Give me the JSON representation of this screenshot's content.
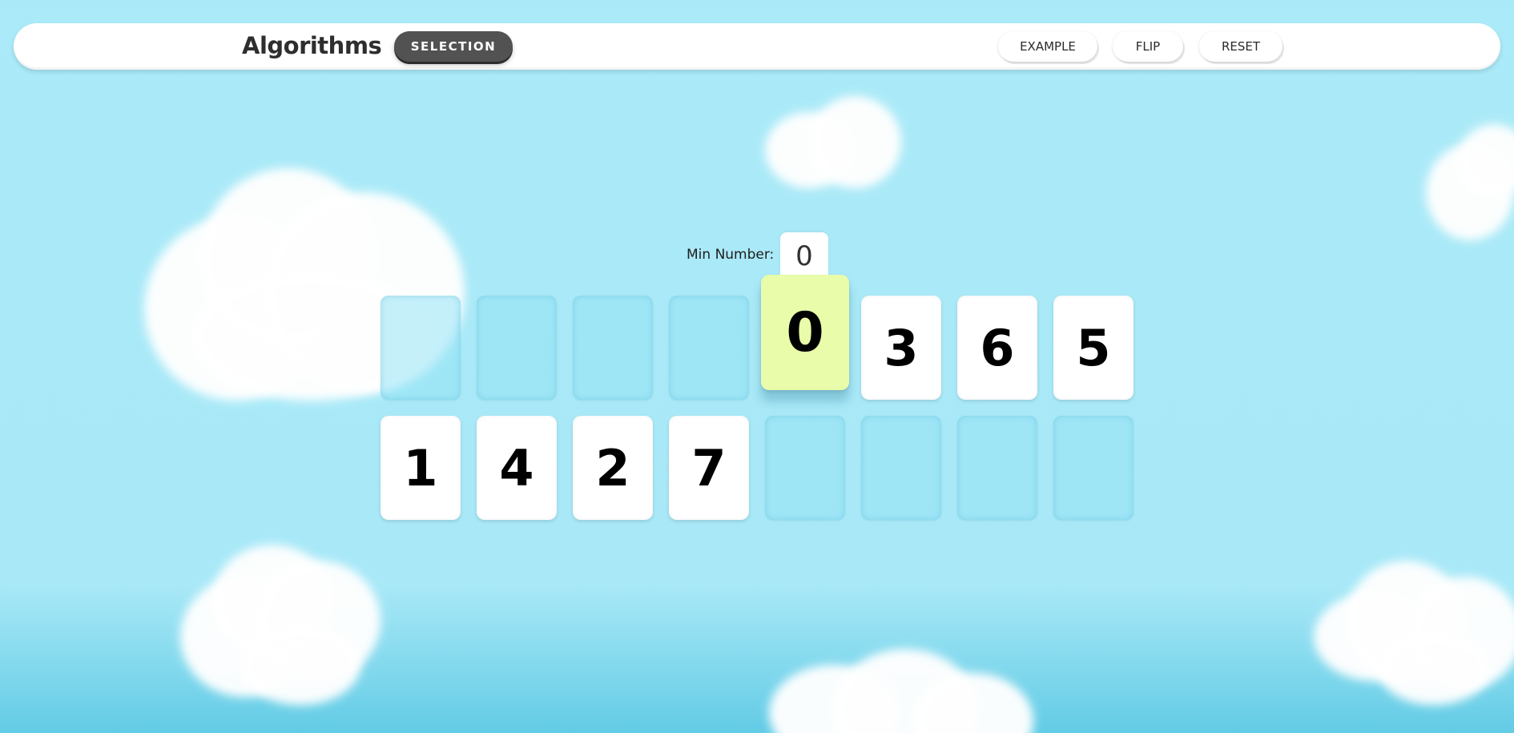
{
  "header": {
    "title": "Algorithms",
    "algorithm_button": "SELECTION",
    "buttons": [
      "EXAMPLE",
      "FLIP",
      "RESET"
    ]
  },
  "min_number": {
    "label": "Min Number:",
    "value": "0"
  },
  "top_row": [
    "",
    "",
    "",
    "",
    "0",
    "3",
    "6",
    "5"
  ],
  "bottom_row": [
    "1",
    "4",
    "2",
    "7",
    "",
    "",
    "",
    ""
  ],
  "colors": {
    "sky": "#abeaf8",
    "active_card": "#e8fcaa",
    "dark_button": "#525252"
  },
  "icons": []
}
